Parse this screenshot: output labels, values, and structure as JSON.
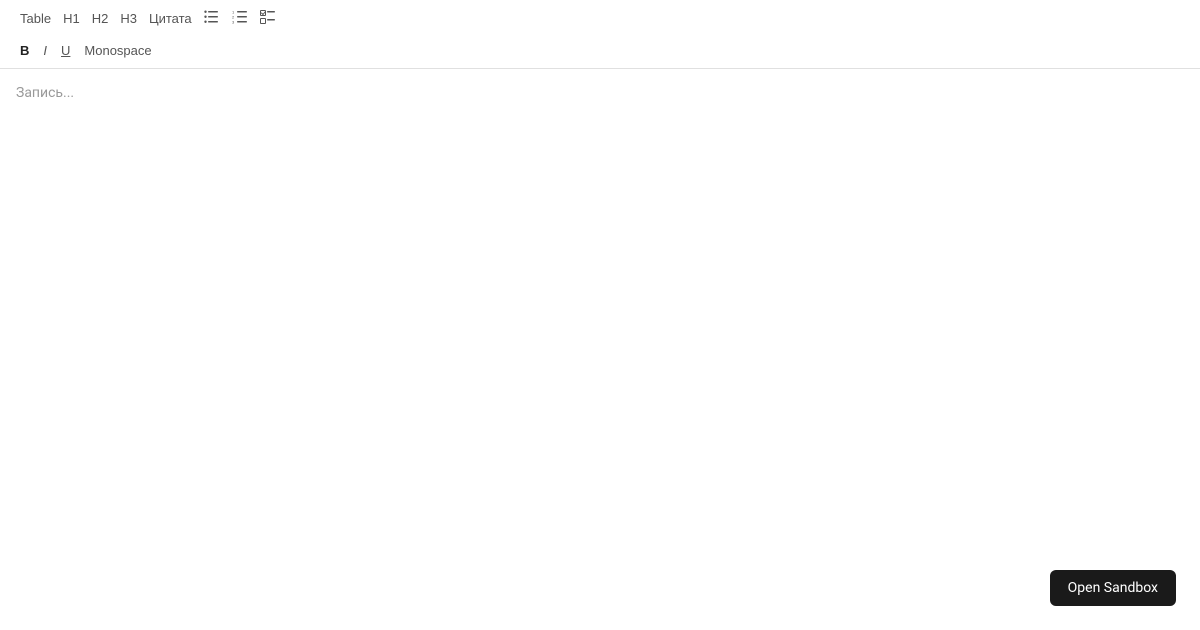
{
  "toolbar": {
    "row1": {
      "table_label": "Table",
      "h1_label": "H1",
      "h2_label": "H2",
      "h3_label": "H3",
      "quote_label": "Цитата"
    },
    "row2": {
      "bold_label": "B",
      "italic_label": "I",
      "underline_label": "U",
      "monospace_label": "Monospace"
    }
  },
  "editor": {
    "placeholder": "Запись..."
  },
  "sandbox": {
    "button_label": "Open Sandbox"
  }
}
